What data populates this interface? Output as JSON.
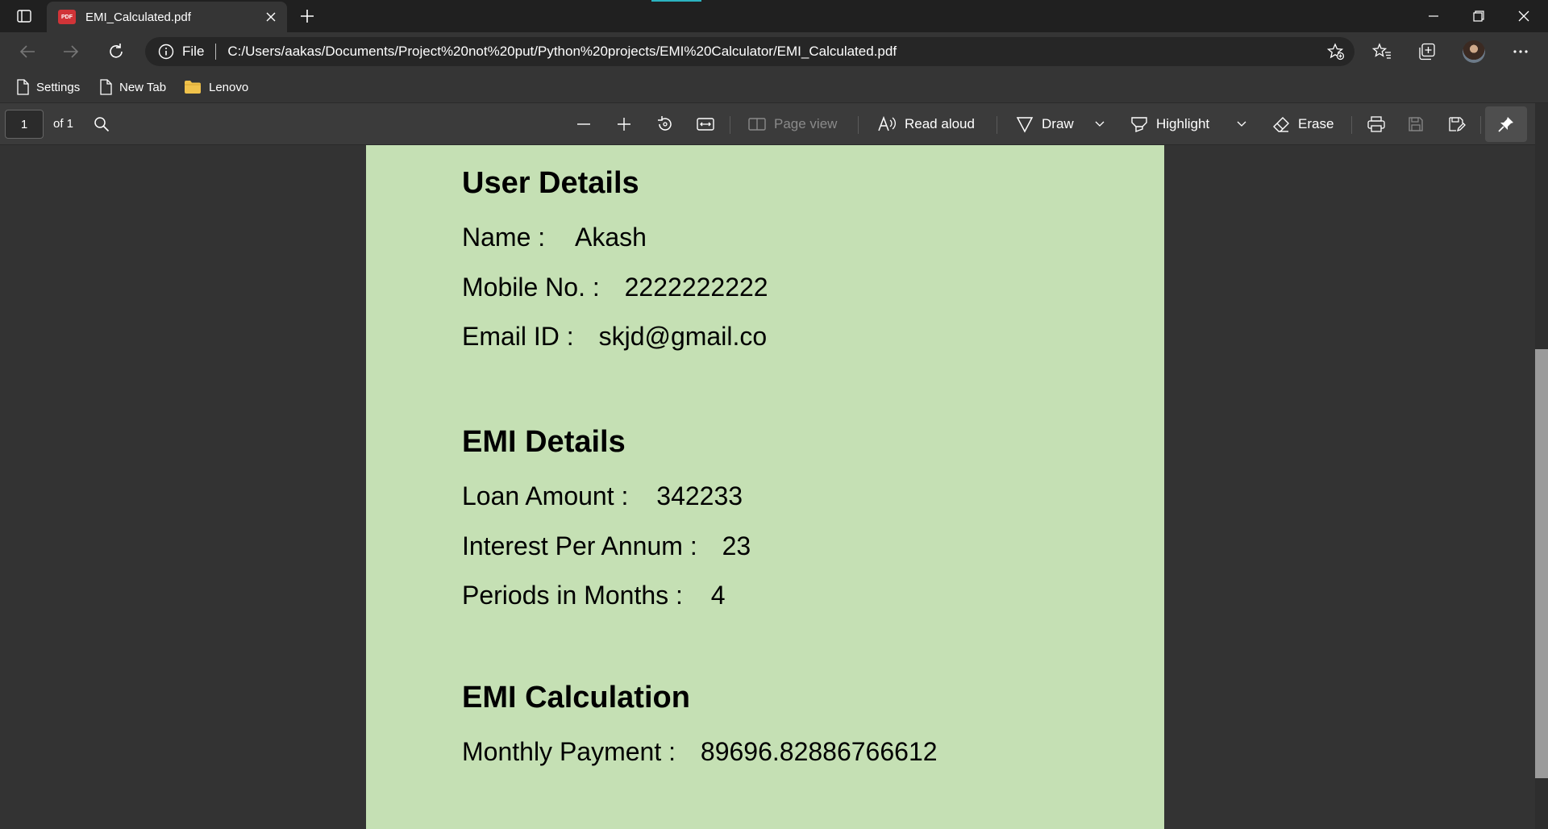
{
  "browser": {
    "tab": {
      "title": "EMI_Calculated.pdf",
      "icon": "pdf-file-icon"
    },
    "address": {
      "scheme": "File",
      "url": "C:/Users/aakas/Documents/Project%20not%20put/Python%20projects/EMI%20Calculator/EMI_Calculated.pdf"
    },
    "favorites": [
      {
        "label": "Settings",
        "icon": "page-icon"
      },
      {
        "label": "New Tab",
        "icon": "page-icon"
      },
      {
        "label": "Lenovo",
        "icon": "folder-icon"
      }
    ],
    "colors": {
      "titlebar": "#202020",
      "toolbar": "#353535",
      "pdf_toolbar": "#3b3b3b",
      "page_bg": "#c5e0b4",
      "accent": "#2bb3c0"
    }
  },
  "pdf_toolbar": {
    "page_number": "1",
    "page_of": "of 1",
    "page_view_label": "Page view",
    "read_aloud_label": "Read aloud",
    "draw_label": "Draw",
    "highlight_label": "Highlight",
    "erase_label": "Erase"
  },
  "document": {
    "user_section": {
      "heading": "User Details",
      "name_label": "Name :",
      "name_value": "Akash",
      "mobile_label": "Mobile No. :",
      "mobile_value": "2222222222",
      "email_label": "Email ID :",
      "email_value": "skjd@gmail.co"
    },
    "emi_section": {
      "heading": "EMI Details",
      "loan_label": "Loan Amount :",
      "loan_value": "342233",
      "interest_label": "Interest Per Annum :",
      "interest_value": "23",
      "period_label": "Periods in Months :",
      "period_value": "4"
    },
    "calc_section": {
      "heading": "EMI Calculation",
      "monthly_label": "Monthly Payment :",
      "monthly_value": "89696.82886766612"
    }
  }
}
